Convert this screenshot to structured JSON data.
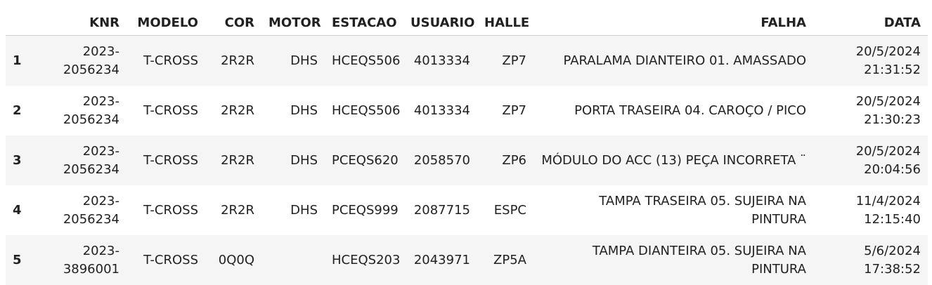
{
  "table": {
    "columns": [
      "",
      "KNR",
      "MODELO",
      "COR",
      "MOTOR",
      "ESTACAO",
      "USUARIO",
      "HALLE",
      "FALHA",
      "DATA"
    ],
    "rows": [
      {
        "idx": "1",
        "knr": "2023-\n2056234",
        "modelo": "T-CROSS",
        "cor": "2R2R",
        "motor": "DHS",
        "estacao": "HCEQS506",
        "usuario": "4013334",
        "halle": "ZP7",
        "falha": "PARALAMA DIANTEIRO 01. AMASSADO",
        "data": "20/5/2024\n21:31:52"
      },
      {
        "idx": "2",
        "knr": "2023-\n2056234",
        "modelo": "T-CROSS",
        "cor": "2R2R",
        "motor": "DHS",
        "estacao": "HCEQS506",
        "usuario": "4013334",
        "halle": "ZP7",
        "falha": "PORTA TRASEIRA 04. CAROÇO / PICO",
        "data": "20/5/2024\n21:30:23"
      },
      {
        "idx": "3",
        "knr": "2023-\n2056234",
        "modelo": "T-CROSS",
        "cor": "2R2R",
        "motor": "DHS",
        "estacao": "PCEQS620",
        "usuario": "2058570",
        "halle": "ZP6",
        "falha": "MÓDULO DO ACC (13) PEÇA INCORRETA ¨",
        "data": "20/5/2024\n20:04:56"
      },
      {
        "idx": "4",
        "knr": "2023-\n2056234",
        "modelo": "T-CROSS",
        "cor": "2R2R",
        "motor": "DHS",
        "estacao": "PCEQS999",
        "usuario": "2087715",
        "halle": "ESPC",
        "falha": "TAMPA TRASEIRA 05. SUJEIRA NA PINTURA",
        "data": "11/4/2024\n12:15:40"
      },
      {
        "idx": "5",
        "knr": "2023-\n3896001",
        "modelo": "T-CROSS",
        "cor": "0Q0Q",
        "motor": "",
        "estacao": "HCEQS203",
        "usuario": "2043971",
        "halle": "ZP5A",
        "falha": "TAMPA DIANTEIRA 05. SUJEIRA NA\nPINTURA",
        "data": "5/6/2024 17:38:52"
      }
    ]
  }
}
